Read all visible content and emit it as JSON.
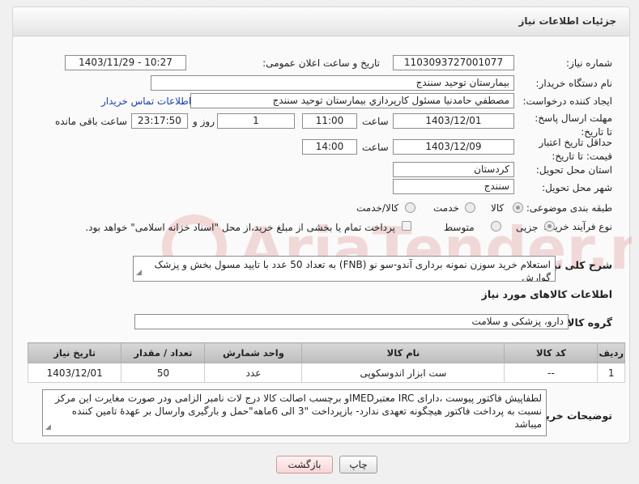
{
  "header": {
    "title": "جزئیات اطلاعات نیاز"
  },
  "form": {
    "need_number": {
      "label": "شماره نیاز:",
      "value": "1103093727001077"
    },
    "announce": {
      "label": "تاریخ و ساعت اعلان عمومی:",
      "value": "1403/11/29 - 10:27"
    },
    "buyer_org": {
      "label": "نام دستگاه خریدار:",
      "value": "بیمارستان توحید سنندج"
    },
    "creator": {
      "label": "ایجاد کننده درخواست:",
      "value": "مصطفي حامدنيا مسئول كارپردازي بيمارستان توحيد سنندج",
      "contact_link": "اطلاعات تماس خریدار"
    },
    "reply_deadline": {
      "label": "مهلت ارسال پاسخ: تا تاریخ:",
      "date": "1403/12/01",
      "time_label": "ساعت",
      "time": "11:00",
      "days": "1",
      "days_label": "روز و",
      "remaining": "23:17:50",
      "remaining_label": "ساعت باقی مانده"
    },
    "price_validity": {
      "label": "حداقل تاریخ اعتبار قیمت: تا تاریخ:",
      "date": "1403/12/09",
      "time_label": "ساعت",
      "time": "14:00"
    },
    "province": {
      "label": "استان محل تحویل:",
      "value": "کردستان"
    },
    "city": {
      "label": "شهر محل تحویل:",
      "value": "سنندج"
    },
    "category": {
      "label": "طبقه بندی موضوعی:",
      "options": [
        "کالا",
        "خدمت",
        "کالا/خدمت"
      ],
      "selected": "کالا"
    },
    "purchase_type": {
      "label": "نوع فرآیند خرید :",
      "options": [
        "جزیی",
        "متوسط"
      ],
      "selected": "جزیی",
      "note": "پرداخت تمام یا بخشی از مبلغ خرید،از محل \"اسناد خزانه اسلامی\" خواهد بود."
    },
    "description": {
      "label": "شرح کلی نیاز:",
      "value": "استعلام خرید سوزن نمونه برداری آندو-سو نو (FNB) به تعداد 50 عدد با تایید مسول بخش و پزشک گوارش"
    }
  },
  "goods": {
    "section_title": "اطلاعات کالاهای مورد نیاز",
    "group_label": "گروه کالا:",
    "group_value": "دارو، پزشکی و سلامت",
    "table": {
      "headers": [
        "ردیف",
        "کد کالا",
        "نام کالا",
        "واحد شمارش",
        "تعداد / مقدار",
        "تاریخ نیاز"
      ],
      "rows": [
        [
          "1",
          "--",
          "ست ابزار اندوسکوپی",
          "عدد",
          "50",
          "1403/12/01"
        ]
      ]
    }
  },
  "buyer_notes": {
    "label": "توضیحات خریدار:",
    "value": "لطفاپیش فاکتور پیوست ،دارای IRC معتبرIMEDو برچسب اصالت کالا درج لات نامبر الزامی ودر صورت مغایرت این مرکز نسبت به پرداخت فاکتور هیچگونه تعهدی ندارد- بازپرداخت \"3 الی 6ماهه\"حمل و بارگیری وارسال بر عهدهٔ تامین کننده میباشد"
  },
  "buttons": {
    "print": "چاپ",
    "back": "بازگشت"
  },
  "watermark_text": "AriaTender.neT",
  "colors": {
    "link": "#1a3fb5",
    "back_button": "#f8d6d6"
  }
}
